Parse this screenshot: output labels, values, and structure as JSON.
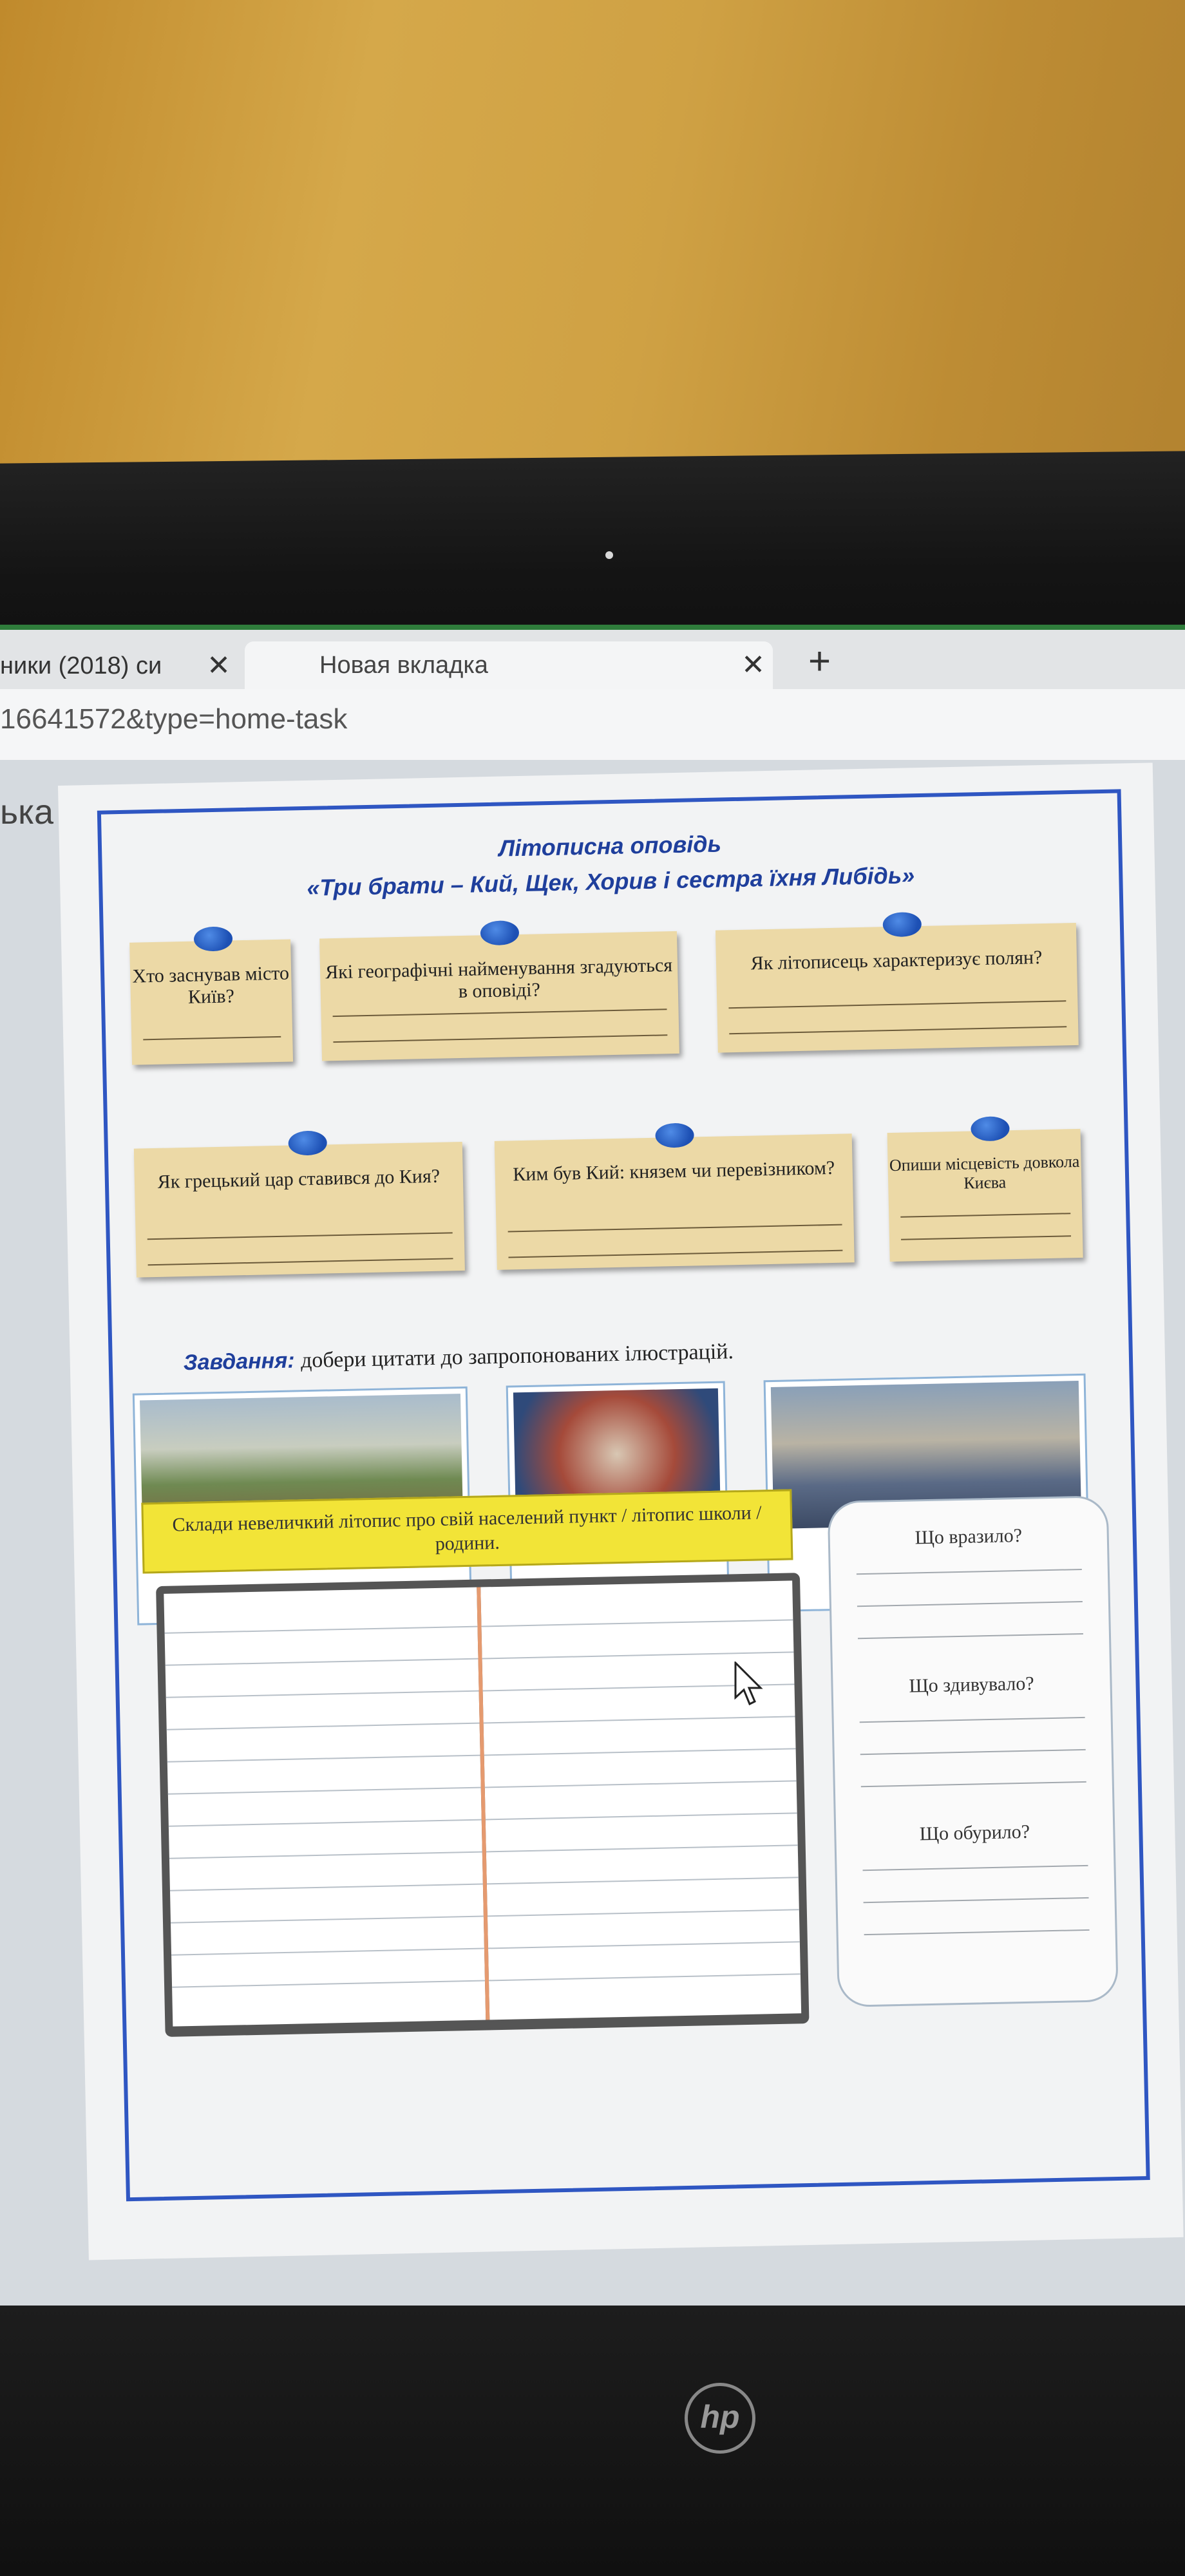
{
  "browser": {
    "tabs": [
      {
        "label": "ники (2018) си",
        "close": "✕"
      },
      {
        "label": "Новая вкладка",
        "close": "✕"
      }
    ],
    "new_tab": "+",
    "url": "16641572&type=home-task"
  },
  "side_text": "ька",
  "worksheet": {
    "title": "Літописна оповідь",
    "subtitle": "«Три брати – Кий, Щек, Хорив і сестра їхня Либідь»",
    "questions": [
      "Хто заснував місто Київ?",
      "Які географічні найменування згадуються в оповіді?",
      "Як літописець характеризує полян?",
      "Як грецький цар ставився до Кия?",
      "Ким був Кий: князем чи перевізником?",
      "Опиши місцевість довкола Києва"
    ],
    "task_label": "Завдання:",
    "task_text": "добери цитати до запропонованих ілюстрацій.",
    "chronicle_prompt": "Склади невеличкий літопис про свій населений пункт / літопис школи / родини.",
    "reflection": [
      "Що вразило?",
      "Що здивувало?",
      "Що обурило?"
    ]
  },
  "laptop_logo": "hp",
  "colors": {
    "frame": "#2f56c2",
    "note": "#ecd9a6",
    "yellow": "#f2e437",
    "title": "#1f3f9c"
  }
}
